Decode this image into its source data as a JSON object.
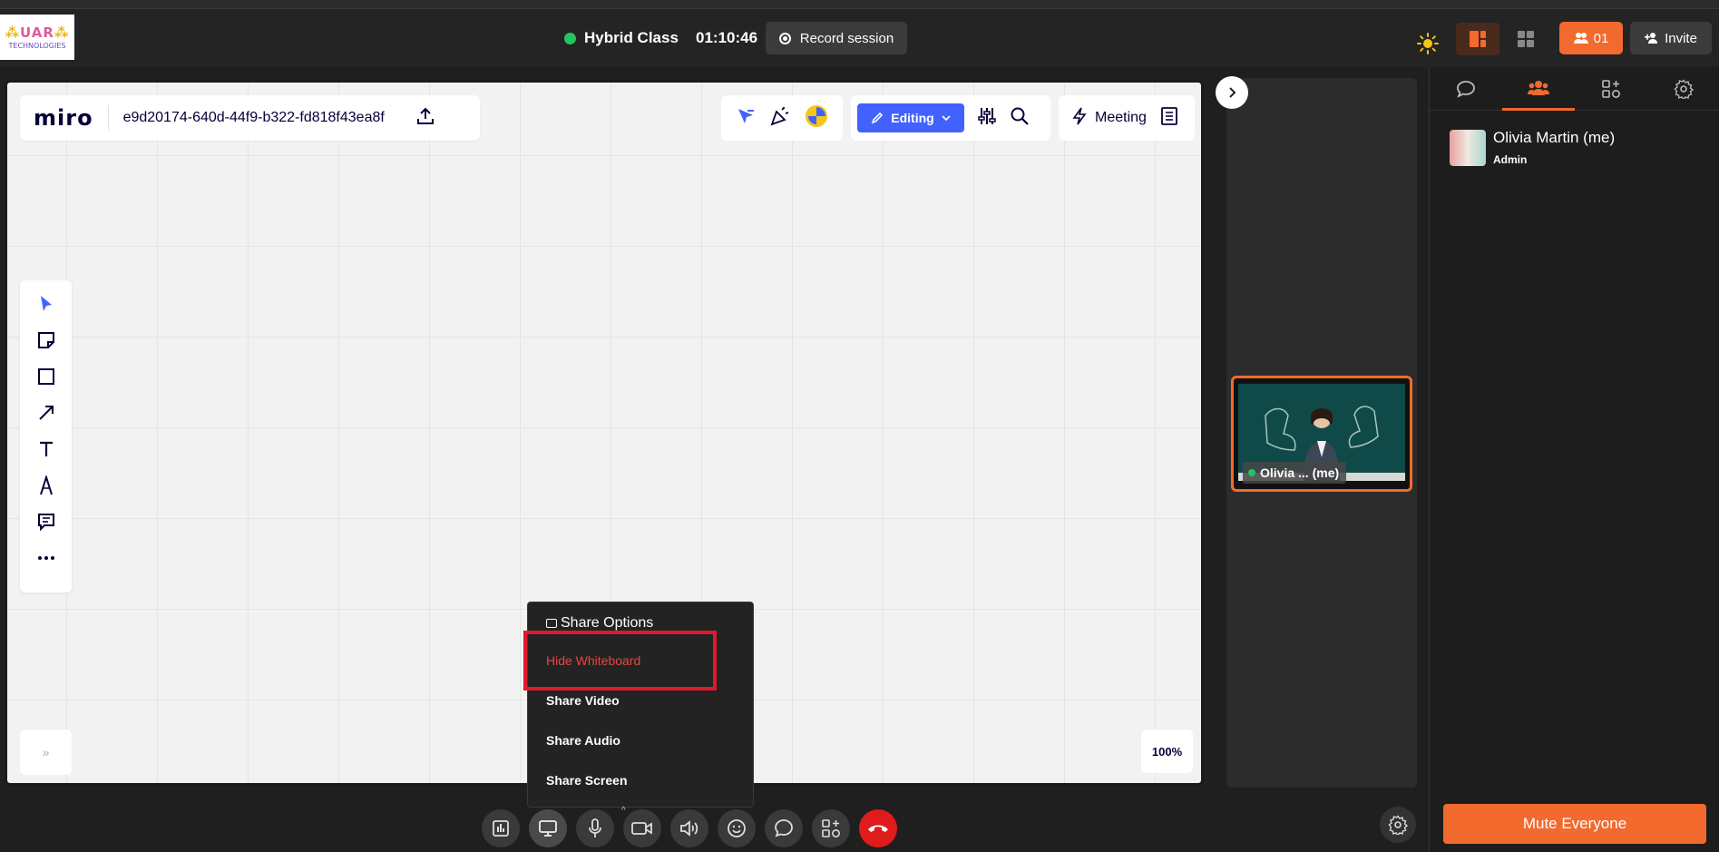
{
  "app": {
    "logo_line1": "UAR",
    "logo_line2": "TECHNOLOGIES",
    "class_name": "Hybrid Class",
    "timer": "01:10:46",
    "record_label": "Record session",
    "participants_count": "01",
    "invite_label": "Invite"
  },
  "miro": {
    "logo": "miro",
    "board_id": "e9d20174-640d-44f9-b322-fd818f43ea8f",
    "editing_label": "Editing",
    "meeting_label": "Meeting",
    "zoom": "100%",
    "tools": [
      "select-icon",
      "sticky-note-icon",
      "rectangle-icon",
      "arrow-icon",
      "text-icon",
      "pen-icon",
      "comment-icon",
      "more-icon"
    ]
  },
  "video": {
    "tile_name": "Olivia ... (me)"
  },
  "panel": {
    "tabs": [
      "chat-icon",
      "participants-icon",
      "apps-icon",
      "settings-icon"
    ],
    "active_tab": "participants-icon",
    "participant_name": "Olivia Martin (me)",
    "participant_role": "Admin",
    "mute_all_label": "Mute Everyone"
  },
  "share_menu": {
    "title": "Share Options",
    "items": [
      "Hide Whiteboard",
      "Share Video",
      "Share Audio",
      "Share Screen"
    ]
  },
  "colors": {
    "accent": "#f26a2e",
    "miro_blue": "#4262ff",
    "danger": "#e01b1b",
    "online": "#22c55e"
  }
}
